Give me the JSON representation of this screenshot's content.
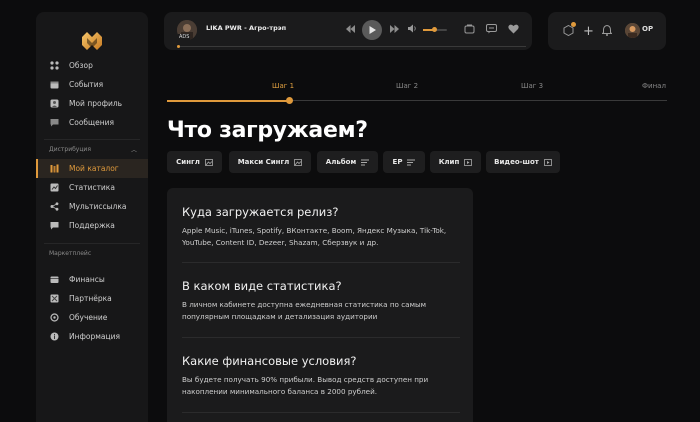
{
  "sidebar": {
    "items": [
      {
        "label": "Обзор",
        "icon": "dashboard-grid-icon"
      },
      {
        "label": "События",
        "icon": "calendar-icon"
      },
      {
        "label": "Мой профиль",
        "icon": "user-profile-icon"
      },
      {
        "label": "Сообщения",
        "icon": "messages-icon"
      }
    ],
    "section_distribution": "Дистрибуция",
    "distribution_items": [
      {
        "label": "Мой каталог",
        "icon": "catalog-icon",
        "active": true
      },
      {
        "label": "Статистика",
        "icon": "statistics-icon"
      },
      {
        "label": "Мультиссылка",
        "icon": "multilink-icon"
      },
      {
        "label": "Поддержка",
        "icon": "support-icon"
      }
    ],
    "section_marketplace": "Маркетплейс",
    "marketplace_items": [
      {
        "label": "Финансы",
        "icon": "finance-icon"
      },
      {
        "label": "Партнёрка",
        "icon": "partner-icon"
      },
      {
        "label": "Обучение",
        "icon": "education-icon"
      },
      {
        "label": "Информация",
        "icon": "info-icon"
      }
    ]
  },
  "player": {
    "ads_label": "ADS",
    "track": "LIKA PWR - Агро-трэп",
    "volume_fraction": 0.55,
    "progress_fraction": 0.0
  },
  "header": {
    "initials": "OP"
  },
  "steps": {
    "labels": [
      "Шаг 1",
      "Шаг 2",
      "Шаг 3",
      "Финал"
    ],
    "active_index": 0
  },
  "page": {
    "title": "Что загружаем?",
    "types": [
      "Сингл",
      "Макси Сингл",
      "Альбом",
      "EP",
      "Клип",
      "Видео-шот"
    ]
  },
  "faq": [
    {
      "question": "Куда загружается релиз?",
      "answer": "Apple Music, iTunes, Spotify, ВКонтакте, Boom, Яндекс Музыка, Tik-Tok, YouTube, Content ID, Dezeer, Shazam, Сберзвук и др."
    },
    {
      "question": "В каком виде статистика?",
      "answer": "В личном кабинете доступна ежедневная статистика по самым популярным площадкам и детализация аудитории"
    },
    {
      "question": "Какие финансовые условия?",
      "answer": "Вы будете получать 90% прибыли. Вывод средств доступен при накоплении минимального баланса в 2000 рублей."
    }
  ],
  "colors": {
    "accent": "#e09a3c",
    "background": "#0c0c0d",
    "panel": "#1b1b1c"
  }
}
